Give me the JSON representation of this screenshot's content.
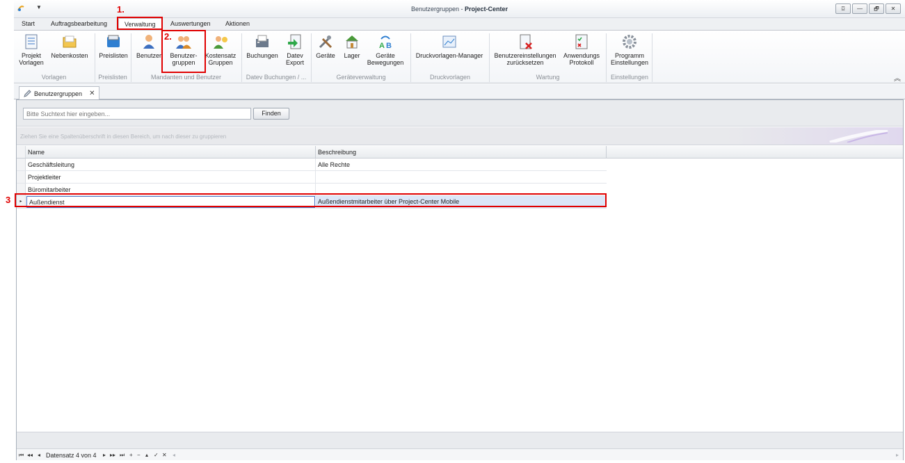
{
  "window": {
    "title_prefix": "Benutzergruppen -",
    "title_app": "Project-Center",
    "controls": [
      "⌼",
      "—",
      "🗗",
      "✕"
    ]
  },
  "ribbon_tabs": [
    "Start",
    "Auftragsbearbeitung",
    "Verwaltung",
    "Auswertungen",
    "Aktionen"
  ],
  "ribbon": {
    "buttons": {
      "projekt_vorlagen": [
        "Projekt",
        "Vorlagen"
      ],
      "nebenkosten": "Nebenkosten",
      "preislisten": "Preislisten",
      "benutzer": "Benutzer",
      "benutzergruppen": [
        "Benutzer-",
        "gruppen"
      ],
      "kostensatz": [
        "Kostensatz",
        "Gruppen"
      ],
      "buchungen": "Buchungen",
      "datev_export": [
        "Datev",
        "Export"
      ],
      "geraete": "Geräte",
      "lager": "Lager",
      "geraete_bew": [
        "Geräte",
        "Bewegungen"
      ],
      "druckvorlagen": "Druckvorlagen-Manager",
      "benutzereinstellungen": [
        "Benutzereinstellungen",
        "zurücksetzen"
      ],
      "anwendungs": [
        "Anwendungs",
        "Protokoll"
      ],
      "programm": [
        "Programm",
        "Einstellungen"
      ]
    },
    "groups": [
      "Vorlagen",
      "Preislisten",
      "Mandanten und Benutzer",
      "Datev Buchungen / ...",
      "Geräteverwaltung",
      "Druckvorlagen",
      "Wartung",
      "Einstellungen"
    ]
  },
  "doc_tab": {
    "label": "Benutzergruppen",
    "close": "✕"
  },
  "search": {
    "placeholder": "Bitte Suchtext hier eingeben...",
    "button": "Finden"
  },
  "group_panel_hint": "Ziehen Sie eine Spaltenüberschrift in diesen Bereich, um nach dieser zu gruppieren",
  "grid": {
    "columns": [
      "Name",
      "Beschreibung"
    ],
    "rows": [
      {
        "name": "Geschäftsleitung",
        "beschreibung": "Alle Rechte"
      },
      {
        "name": "Projektleiter",
        "beschreibung": ""
      },
      {
        "name": "Büromitarbeiter",
        "beschreibung": ""
      },
      {
        "name": "Außendienst",
        "beschreibung": "Außendienstmitarbeiter über Project-Center Mobile"
      }
    ],
    "selected_indicator": "▸"
  },
  "navigator": {
    "left_buttons": [
      "⏮",
      "◂◂",
      "◂"
    ],
    "record_text": "Datensatz 4 von 4",
    "right_buttons": [
      "▸",
      "▸▸",
      "⏭",
      "+",
      "−",
      "▴",
      "✓",
      "✕"
    ],
    "scroll_left": "◂",
    "scroll_right": "▸"
  },
  "annotations": [
    "1.",
    "2.",
    "3"
  ],
  "colors": {
    "annotation": "#e00000",
    "selection": "#dbe6f8",
    "accent": "#4a74c3"
  }
}
